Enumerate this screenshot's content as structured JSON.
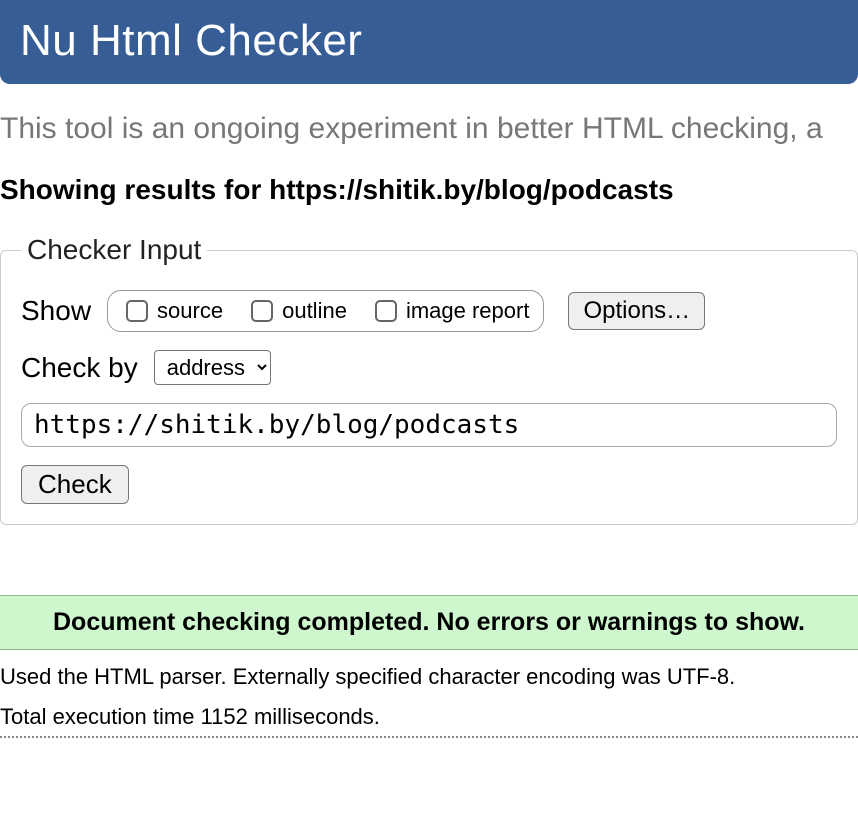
{
  "header": {
    "title": "Nu Html Checker"
  },
  "subhead": "This tool is an ongoing experiment in better HTML checking, a",
  "results_heading": "Showing results for https://shitik.by/blog/podcasts",
  "checker_input": {
    "legend": "Checker Input",
    "show_label": "Show",
    "checkboxes": {
      "source": "source",
      "outline": "outline",
      "image_report": "image report"
    },
    "options_button": "Options…",
    "checkby_label": "Check by",
    "checkby_selected": "address",
    "url_value": "https://shitik.by/blog/podcasts",
    "check_button": "Check"
  },
  "success_message": "Document checking completed. No errors or warnings to show.",
  "parser_line": "Used the HTML parser. Externally specified character encoding was UTF-8.",
  "exec_line": "Total execution time 1152 milliseconds."
}
